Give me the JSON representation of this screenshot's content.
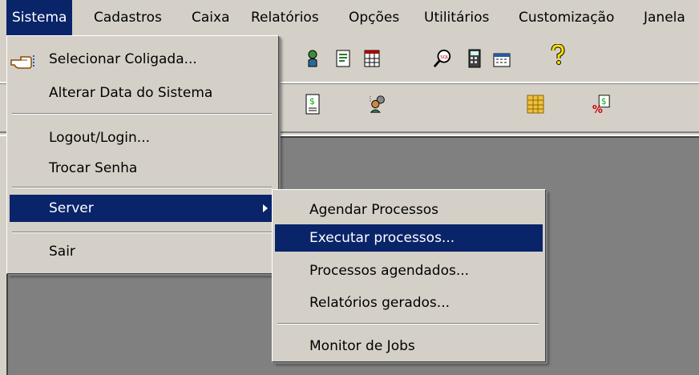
{
  "menubar": {
    "items": [
      {
        "label": "Sistema"
      },
      {
        "label": "Cadastros"
      },
      {
        "label": "Caixa"
      },
      {
        "label": "Relatórios"
      },
      {
        "label": "Opções"
      },
      {
        "label": "Utilitários"
      },
      {
        "label": "Customização"
      },
      {
        "label": "Janela"
      }
    ]
  },
  "sistema_menu": {
    "selecionar_coligada": "Selecionar Coligada...",
    "alterar_data": "Alterar Data do Sistema",
    "logout_login": "Logout/Login...",
    "trocar_senha": "Trocar Senha",
    "server": "Server",
    "sair": "Sair"
  },
  "server_menu": {
    "agendar_processos": "Agendar Processos",
    "executar_processos": "Executar processos...",
    "processos_agendados": "Processos agendados...",
    "relatorios_gerados": "Relatórios gerados...",
    "monitor_jobs": "Monitor de Jobs"
  },
  "colors": {
    "face": "#d4d0c8",
    "highlight": "#0a246a",
    "workspace": "#808080"
  }
}
